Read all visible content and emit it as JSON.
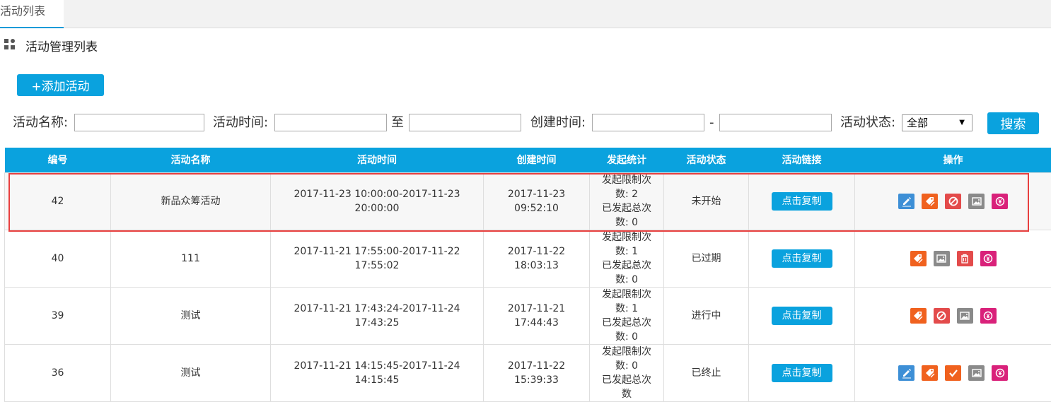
{
  "tab": {
    "label": "活动列表"
  },
  "section": {
    "title": "活动管理列表"
  },
  "add_button": {
    "label": "+添加活动"
  },
  "filters": {
    "name_label": "活动名称:",
    "time_label": "活动时间:",
    "time_sep": "至",
    "create_label": "创建时间:",
    "create_sep": "-",
    "status_label": "活动状态:",
    "status_value": "全部",
    "search_label": "搜索"
  },
  "table": {
    "headers": [
      "编号",
      "活动名称",
      "活动时间",
      "创建时间",
      "发起统计",
      "活动状态",
      "活动链接",
      "操作"
    ],
    "copy_label": "点击复制",
    "rows": [
      {
        "id": "42",
        "name": "新品众筹活动",
        "time1": "2017-11-23 10:00:00-2017-11-23",
        "time2": "20:00:00",
        "created1": "2017-11-23",
        "created2": "09:52:10",
        "stat1": "发起限制次",
        "stat2": "数: 2",
        "stat3": "已发起总次",
        "stat4": "数: 0",
        "status": "未开始",
        "ops": [
          "edit-icon",
          "tag-icon",
          "ban-icon",
          "image-icon",
          "coupon-icon"
        ]
      },
      {
        "id": "40",
        "name": "111",
        "time1": "2017-11-21 17:55:00-2017-11-22",
        "time2": "17:55:02",
        "created1": "2017-11-22",
        "created2": "18:03:13",
        "stat1": "发起限制次",
        "stat2": "数: 1",
        "stat3": "已发起总次",
        "stat4": "数: 0",
        "status": "已过期",
        "ops": [
          "tag-icon",
          "image-icon",
          "trash-icon",
          "coupon-icon"
        ]
      },
      {
        "id": "39",
        "name": "测试",
        "time1": "2017-11-21 17:43:24-2017-11-24",
        "time2": "17:43:25",
        "created1": "2017-11-21",
        "created2": "17:44:43",
        "stat1": "发起限制次",
        "stat2": "数: 1",
        "stat3": "已发起总次",
        "stat4": "数: 0",
        "status": "进行中",
        "ops": [
          "tag-icon",
          "ban-icon",
          "image-icon",
          "coupon-icon"
        ]
      },
      {
        "id": "36",
        "name": "测试",
        "time1": "2017-11-21 14:15:45-2017-11-24",
        "time2": "14:15:45",
        "created1": "2017-11-22",
        "created2": "15:39:33",
        "stat1": "发起限制次",
        "stat2": "数: 0",
        "stat3": "已发起总次",
        "stat4": "数",
        "status": "已终止",
        "ops": [
          "edit-icon",
          "tag-icon",
          "check-icon",
          "image-icon",
          "coupon-icon"
        ]
      }
    ]
  },
  "colors": {
    "accent": "#0aa2de",
    "highlight": "#e8403f"
  }
}
